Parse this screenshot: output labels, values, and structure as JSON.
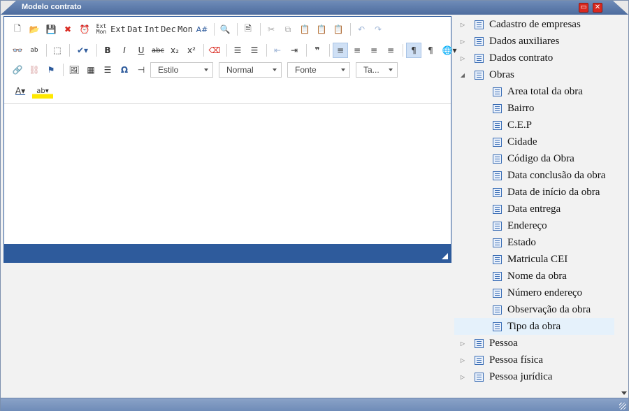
{
  "window": {
    "title": "Modelo contrato"
  },
  "toolbar": {
    "row1_text_buttons": [
      "Ext Mon",
      "Ext",
      "Dat",
      "Int",
      "Dec",
      "Mon"
    ],
    "style_combo": "Estilo",
    "format_combo": "Normal",
    "font_combo": "Fonte",
    "size_combo": "Ta..."
  },
  "tree": {
    "top_items": [
      {
        "label": "Cadastro de empresas",
        "expanded": false
      },
      {
        "label": "Dados auxiliares",
        "expanded": false
      },
      {
        "label": "Dados contrato",
        "expanded": false
      },
      {
        "label": "Obras",
        "expanded": true
      }
    ],
    "obras_children": [
      "Area total da obra",
      "Bairro",
      "C.E.P",
      "Cidade",
      "Código da Obra",
      "Data conclusão da obra",
      "Data de início da obra",
      "Data entrega",
      "Endereço",
      "Estado",
      "Matricula CEI",
      "Nome da obra",
      "Número endereço",
      "Observação da obra",
      "Tipo da obra"
    ],
    "selected": "Tipo da obra",
    "bottom_items": [
      {
        "label": "Pessoa",
        "expanded": false
      },
      {
        "label": "Pessoa física",
        "expanded": false
      },
      {
        "label": "Pessoa jurídica",
        "expanded": false
      }
    ]
  },
  "colors": {
    "accent": "#2e5b9c",
    "title_bar": "#5a77a8",
    "selected_row": "#e5f1fb"
  }
}
